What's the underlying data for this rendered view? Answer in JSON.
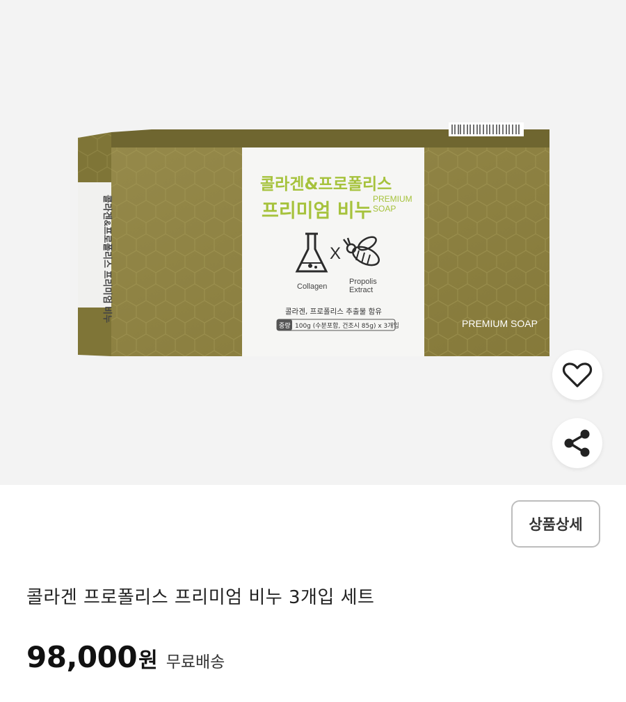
{
  "product_image": {
    "box_title_line1": "콜라겐&프로폴리스",
    "box_title_line2": "프리미엄 비누",
    "box_badge_line1": "PREMIUM",
    "box_badge_line2": "SOAP",
    "ingredient_left": "Collagen",
    "ingredient_x": "X",
    "ingredient_right_line1": "Propolis",
    "ingredient_right_line2": "Extract",
    "box_desc": "콜라겐, 프로폴리스 추출물 함유",
    "weight_tag": "중량",
    "weight_text": "100g (수분포함, 건조시 85g) x 3개입",
    "side_brand": "PREMIUM SOAP",
    "side_title": "콜라겐&프로폴리스 프리미엄 비누"
  },
  "actions": {
    "like_icon": "heart-outline-icon",
    "share_icon": "share-icon"
  },
  "detail_button": {
    "label": "상품상세"
  },
  "product": {
    "title": "콜라겐 프로폴리스 프리미엄 비누 3개입 세트",
    "price": "98,000",
    "price_unit": "원",
    "shipping": "무료배송"
  },
  "colors": {
    "box_gold": "#8d8240",
    "title_green": "#a6c23c",
    "background": "#f3f3f3"
  }
}
